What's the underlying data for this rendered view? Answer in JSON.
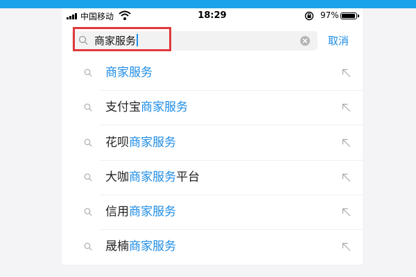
{
  "status_bar": {
    "carrier": "中国移动",
    "time": "18:29",
    "battery": "97%",
    "battery_level": 0.97
  },
  "search": {
    "query": "商家服务",
    "cancel_label": "取消"
  },
  "suggestions": [
    {
      "prefix": "",
      "match": "商家服务",
      "suffix": ""
    },
    {
      "prefix": "支付宝",
      "match": "商家服务",
      "suffix": ""
    },
    {
      "prefix": "花呗",
      "match": "商家服务",
      "suffix": ""
    },
    {
      "prefix": "大咖",
      "match": "商家服务",
      "suffix": "平台"
    },
    {
      "prefix": "信用",
      "match": "商家服务",
      "suffix": ""
    },
    {
      "prefix": "晟楠",
      "match": "商家服务",
      "suffix": ""
    }
  ],
  "colors": {
    "accent": "#1e8ce6",
    "top_band": "#1aa3e8",
    "highlight_border": "#e0383b"
  },
  "icons": {
    "row_left": "search-icon",
    "row_right": "fill-arrow-icon",
    "input_clear": "clear-icon"
  }
}
